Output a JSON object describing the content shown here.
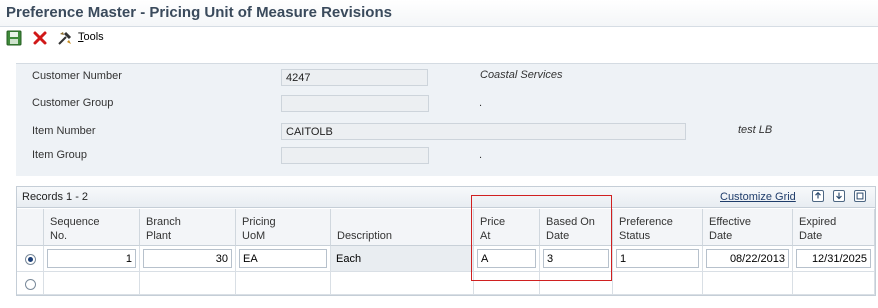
{
  "title": "Preference Master - Pricing Unit of Measure Revisions",
  "toolbar": {
    "save_icon": "save-icon",
    "cancel_icon": "cancel-icon",
    "tools_icon": "tools-icon",
    "tools_label": "ools",
    "tools_underlined_letter": "T"
  },
  "header": {
    "customer_number": {
      "label": "Customer Number",
      "value": "4247",
      "description": "Coastal Services"
    },
    "customer_group": {
      "label": "Customer Group",
      "value": "",
      "description": "."
    },
    "item_number": {
      "label": "Item Number",
      "value": "CAITOLB",
      "description": "test LB"
    },
    "item_group": {
      "label": "Item Group",
      "value": "",
      "description": "."
    }
  },
  "grid": {
    "records_label": "Records 1 - 2",
    "customize_label": "Customize Grid",
    "columns": [
      {
        "line1": "Sequence",
        "line2": "No."
      },
      {
        "line1": "Branch",
        "line2": "Plant"
      },
      {
        "line1": "Pricing",
        "line2": "UoM"
      },
      {
        "line1": "",
        "line2": "Description"
      },
      {
        "line1": "Price",
        "line2": "At"
      },
      {
        "line1": "Based On",
        "line2": "Date"
      },
      {
        "line1": "Preference",
        "line2": "Status"
      },
      {
        "line1": "Effective",
        "line2": "Date"
      },
      {
        "line1": "Expired",
        "line2": "Date"
      }
    ],
    "rows": [
      {
        "selected": true,
        "sequence": "1",
        "branch_plant": "30",
        "pricing_uom": "EA",
        "description": "Each",
        "price_at": "A",
        "based_on_date": "3",
        "preference_status": "1",
        "effective_date": "08/22/2013",
        "expired_date": "12/31/2025"
      }
    ]
  }
}
